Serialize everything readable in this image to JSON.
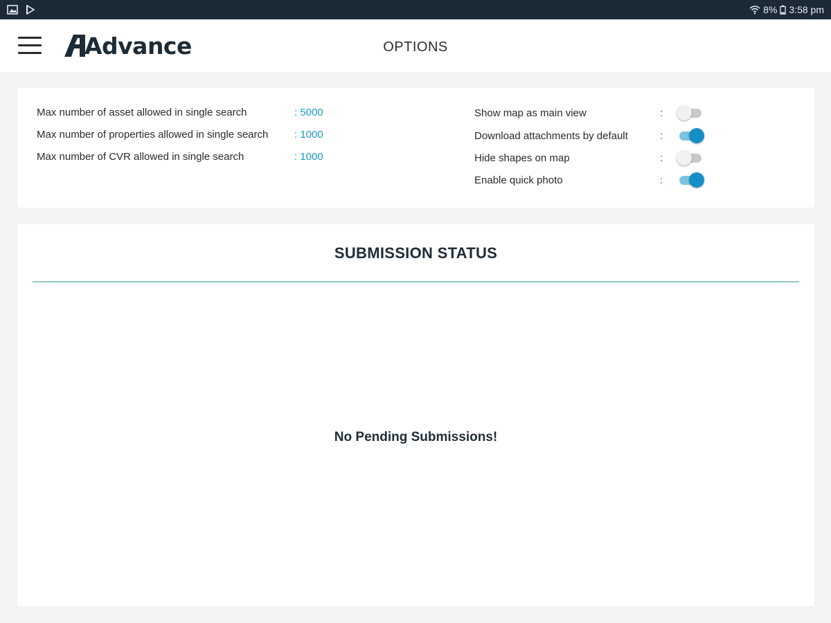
{
  "status_bar": {
    "battery_percent": "8%",
    "time": "3:58 pm",
    "icons": [
      "gallery-icon",
      "play-store-icon",
      "wifi-icon",
      "battery-icon"
    ]
  },
  "app_bar": {
    "menu_icon": "hamburger-menu-icon",
    "logo_text": "Advance",
    "title": "OPTIONS"
  },
  "options": {
    "limits": [
      {
        "label": "Max number of asset allowed in single search",
        "value": ": 5000"
      },
      {
        "label": "Max number of properties allowed in single search",
        "value": ": 1000"
      },
      {
        "label": "Max number of CVR allowed in single search",
        "value": ": 1000"
      }
    ],
    "toggles": [
      {
        "label": "Show map as main view",
        "colon": ":",
        "on": false
      },
      {
        "label": "Download attachments by default",
        "colon": ":",
        "on": true
      },
      {
        "label": "Hide shapes on map",
        "colon": ":",
        "on": false
      },
      {
        "label": "Enable quick photo",
        "colon": ":",
        "on": true
      }
    ]
  },
  "submission": {
    "title": "SUBMISSION STATUS",
    "empty_message": "No Pending Submissions!"
  },
  "colors": {
    "status_bar_bg": "#1b2a36",
    "accent_blue": "#1590c6",
    "value_blue": "#1a9bc4",
    "divider_teal": "#8fcbc4"
  }
}
